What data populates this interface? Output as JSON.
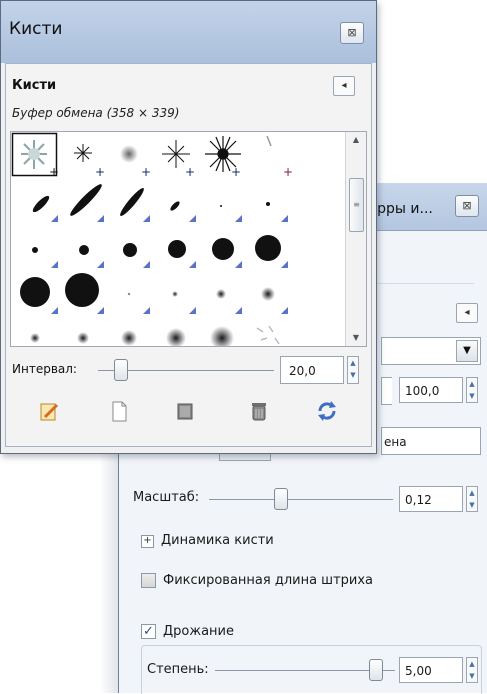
{
  "brushes_dialog": {
    "window_title": "Кисти",
    "close_glyph": "⊠",
    "panel_title": "Кисти",
    "selected_brush_info": "Буфер обмена (358 × 339)",
    "panel_menu_glyph": "◂",
    "interval": {
      "label": "Интервал:",
      "value": "20,0"
    },
    "actions": [
      {
        "name": "edit-brush",
        "icon": "edit-icon"
      },
      {
        "name": "new-brush",
        "icon": "new-document-icon"
      },
      {
        "name": "duplicate-brush",
        "icon": "duplicate-icon"
      },
      {
        "name": "delete-brush",
        "icon": "trash-icon"
      },
      {
        "name": "refresh-brushes",
        "icon": "refresh-icon"
      }
    ]
  },
  "tool_options": {
    "window_title": "трры и...",
    "close_glyph": "⊠",
    "panel_menu_glyph": "◂",
    "opacity_value": "100,0",
    "brush_name_fragment": "ена",
    "scale": {
      "label": "Масштаб:",
      "value": "0,12"
    },
    "dynamics_expander": {
      "glyph": "+",
      "label": "Динамика кисти"
    },
    "fixed_stroke": {
      "label": "Фиксированная длина штриха",
      "checked": false
    },
    "jitter": {
      "label": "Дрожание",
      "checked": true,
      "check_glyph": "✓"
    },
    "degree": {
      "label": "Степень:",
      "value": "5,00"
    }
  },
  "colors": {
    "titlebar": "#b9cbe3",
    "accent_blue": "#5a73c9",
    "crosshair_navy": "#1c2a6b"
  }
}
